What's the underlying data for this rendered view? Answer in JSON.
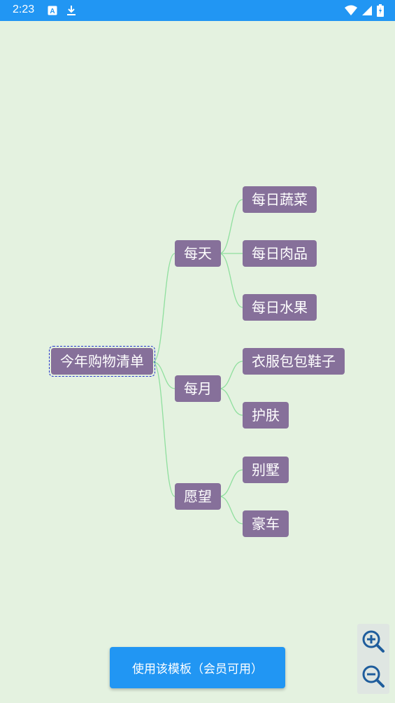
{
  "status_bar": {
    "time": "2:23",
    "icons": [
      "translate-icon",
      "download-icon",
      "wifi-icon",
      "signal-icon",
      "battery-icon"
    ],
    "color": "#2196f3"
  },
  "mindmap": {
    "root": "今年购物清单",
    "branches": [
      {
        "label": "每天",
        "children": [
          "每日蔬菜",
          "每日肉品",
          "每日水果"
        ]
      },
      {
        "label": "每月",
        "children": [
          "衣服包包鞋子",
          "护肤"
        ]
      },
      {
        "label": "愿望",
        "children": [
          "别墅",
          "豪车"
        ]
      }
    ],
    "node_color": "#86709a",
    "link_color": "#8fdf9e"
  },
  "cta": {
    "label": "使用该模板（会员可用）"
  },
  "zoom": {
    "in": "zoom-in-icon",
    "out": "zoom-out-icon"
  }
}
